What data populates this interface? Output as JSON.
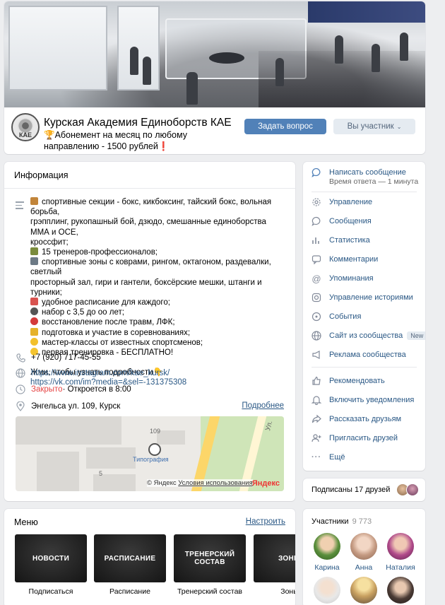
{
  "group": {
    "title": "Курская Академия Единоборств КАЕ",
    "status": "🏆Абонемент на месяц по любому направлению - 1500 рублей❗",
    "logo_text": "КАЕ",
    "ask_button": "Задать вопрос",
    "member_button": "Вы участник"
  },
  "info": {
    "title": "Информация",
    "description_lines": [
      "спортивные секции - бокс, кикбоксинг, тайский бокс, вольная борьба,",
      "грэпплинг, рукопашный бой, дзюдо, смешанные единоборства ММА и ОСЕ,",
      "кроссфит;",
      "15 тренеров-профессионалов;",
      "спортивные зоны с коврами, рингом, октагоном, раздевалки, светлый",
      "просторный зал, гири и гантели, боксёрские мешки, штанги и турники;",
      "удобное расписание для каждого;",
      "набор с 3,5 до оо лет;",
      "восстановление после травм, ЛФК;",
      "подготовка и участие в соревнованиях;",
      "мастер-классы от известных спортсменов;",
      "первая тренировка - БЕСПЛАТНО!",
      "",
      "Жми, чтобы узнать подробности👇"
    ],
    "description_link": "https://vk.com/im?media=&sel=-131375308",
    "phone": "+7 (920) 717-45-55",
    "website": "https://www.instagram.com/kae_kursk/",
    "hours_status": "Закрыто",
    "hours_next": " · Откроется в 8:00",
    "address": "Энгельса ул. 109, Курск",
    "address_more": "Подробнее",
    "map": {
      "house_number": "109",
      "poi_label": "Типография",
      "number_5": "5",
      "street_label": "Ул.",
      "copyright": "© Яндекс",
      "terms": "Условия использования",
      "brand": "Яндекс"
    }
  },
  "menu": {
    "title": "Меню",
    "settings": "Настроить",
    "tiles": [
      {
        "tile_text": "НОВОСТИ",
        "caption": "Подписаться"
      },
      {
        "tile_text": "РАСПИСАНИЕ",
        "caption": "Расписание"
      },
      {
        "tile_text": "ТРЕНЕРСКИЙ СОСТАВ",
        "caption": "Тренерский состав"
      },
      {
        "tile_text": "ЗОНЫ",
        "caption": "Зоны"
      }
    ]
  },
  "actions": {
    "message": "Написать сообщение",
    "response_time": "Время ответа — 1 минута",
    "items": [
      {
        "label": "Управление",
        "icon": "gear-icon"
      },
      {
        "label": "Сообщения",
        "icon": "chat-icon"
      },
      {
        "label": "Статистика",
        "icon": "stats-icon"
      },
      {
        "label": "Комментарии",
        "icon": "comments-icon"
      },
      {
        "label": "Упоминания",
        "icon": "at-icon"
      },
      {
        "label": "Управление историями",
        "icon": "stories-icon"
      },
      {
        "label": "События",
        "icon": "events-icon"
      },
      {
        "label": "Сайт из сообщества",
        "icon": "globe-icon",
        "badge": "New"
      },
      {
        "label": "Реклама сообщества",
        "icon": "megaphone-icon"
      },
      {
        "label": "Рекомендовать",
        "icon": "thumb-up-icon"
      },
      {
        "label": "Включить уведомления",
        "icon": "bell-icon"
      },
      {
        "label": "Рассказать друзьям",
        "icon": "share-icon"
      },
      {
        "label": "Пригласить друзей",
        "icon": "add-user-icon"
      },
      {
        "label": "Ещё",
        "icon": "more-icon"
      }
    ]
  },
  "friends": {
    "text": "Подписаны 17 друзей"
  },
  "members": {
    "title": "Участники",
    "count": "9 773",
    "people": [
      {
        "name": "Карина"
      },
      {
        "name": "Анна"
      },
      {
        "name": "Наталия"
      }
    ]
  },
  "colors": {
    "accent": "#5181b8",
    "link": "#2a5885",
    "closed": "#e64646",
    "background": "#edeef0"
  }
}
